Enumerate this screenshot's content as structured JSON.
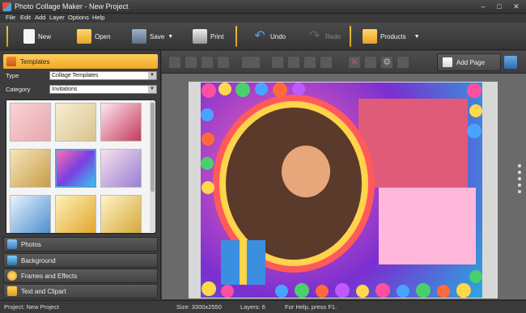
{
  "app": {
    "title": "Photo Collage Maker - New Project"
  },
  "window": {
    "minimize": "–",
    "maximize": "□",
    "close": "✕"
  },
  "menu": [
    "File",
    "Edit",
    "Add",
    "Layer",
    "Options",
    "Help"
  ],
  "toolbar": {
    "new": "New",
    "open": "Open",
    "save": "Save",
    "print": "Print",
    "undo": "Undo",
    "redo": "Redo",
    "products": "Products"
  },
  "left_panel": {
    "templates_header": "Templates",
    "type_label": "Type",
    "type_value": "Collage Templates",
    "category_label": "Category",
    "category_value": "Invitations",
    "sections": [
      "Photos",
      "Background",
      "Frames and Effects",
      "Text and Clipart"
    ]
  },
  "canvas": {
    "add_page": "Add Page"
  },
  "status": {
    "project": "Project: New Project",
    "size": "Size: 3300x2550",
    "layers": "Layers: 6",
    "help": "For Help, press F1."
  },
  "colors": {
    "accent": "#f5b53a",
    "selection": "#4aa3df"
  }
}
